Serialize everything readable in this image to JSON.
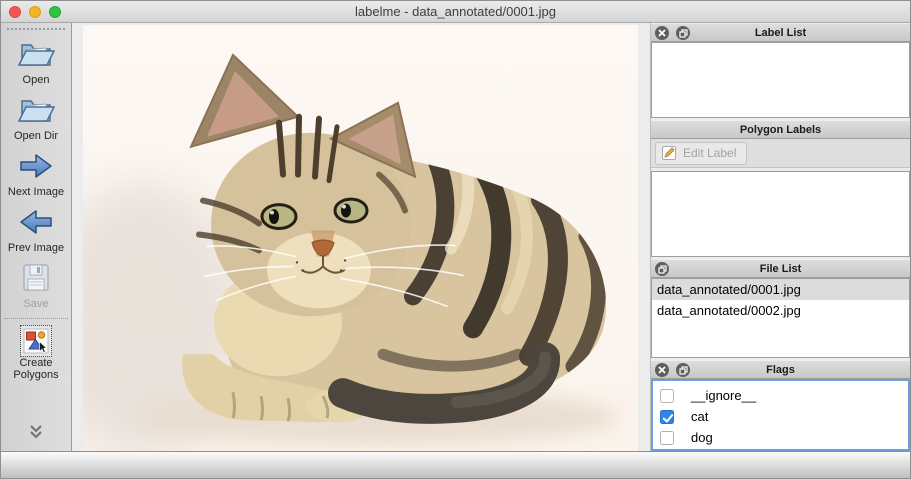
{
  "window": {
    "title": "labelme - data_annotated/0001.jpg"
  },
  "toolbar": {
    "items": [
      {
        "label": "Open",
        "icon": "open-folder-icon",
        "enabled": true,
        "selected": false
      },
      {
        "label": "Open Dir",
        "icon": "open-dir-folder-icon",
        "enabled": true,
        "selected": false
      },
      {
        "label": "Next Image",
        "icon": "next-image-arrow-icon",
        "enabled": true,
        "selected": false
      },
      {
        "label": "Prev Image",
        "icon": "prev-image-arrow-icon",
        "enabled": true,
        "selected": false
      },
      {
        "label": "Save",
        "icon": "save-floppy-icon",
        "enabled": false,
        "selected": false
      },
      {
        "label": "Create Polygons",
        "icon": "create-polygons-icon",
        "enabled": true,
        "selected": true
      }
    ],
    "overflow_icon": "chevron-double-down-icon"
  },
  "canvas": {
    "description": "tabby kitten lying on a white background"
  },
  "docks": {
    "label_list": {
      "title": "Label List",
      "buttons": [
        "close",
        "float"
      ],
      "items": []
    },
    "polygon_labels": {
      "title": "Polygon Labels",
      "edit_label_button": "Edit Label",
      "edit_enabled": false,
      "items": []
    },
    "file_list": {
      "title": "File List",
      "buttons": [
        "float"
      ],
      "items": [
        {
          "name": "data_annotated/0001.jpg",
          "selected": true
        },
        {
          "name": "data_annotated/0002.jpg",
          "selected": false
        }
      ]
    },
    "flags": {
      "title": "Flags",
      "buttons": [
        "close",
        "float"
      ],
      "items": [
        {
          "label": "__ignore__",
          "checked": false
        },
        {
          "label": "cat",
          "checked": true
        },
        {
          "label": "dog",
          "checked": false
        }
      ]
    }
  },
  "colors": {
    "checkbox_checked": "#2f86e8",
    "flags_focus_border": "#69a1d8",
    "selected_row": "#dcdcdc",
    "traffic_red": "#f6564f",
    "traffic_yellow": "#f5b51f",
    "traffic_green": "#30c340"
  }
}
